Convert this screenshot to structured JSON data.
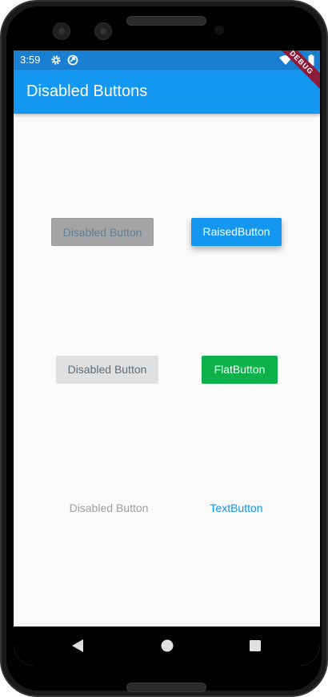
{
  "status_bar": {
    "time": "3:59",
    "color": "#1a7fd0"
  },
  "app_bar": {
    "title": "Disabled Buttons",
    "color": "#1497f0"
  },
  "debug_banner": "DEBUG",
  "buttons": {
    "disabled_raised": "Disabled Button",
    "raised": "RaisedButton",
    "disabled_flat": "Disabled Button",
    "flat": "FlatButton",
    "disabled_text": "Disabled Button",
    "text": "TextButton"
  },
  "colors": {
    "raised": "#1497f0",
    "flat": "#0cb14a",
    "text": "#1497f0",
    "disabled_fill": "#a4a4a4",
    "disabled_flat_fill": "#e0e0e0",
    "disabled_text": "#9e9e9e"
  },
  "icons": {
    "status": [
      "gear-icon",
      "sync-icon",
      "wifi-icon",
      "battery-icon"
    ],
    "nav": [
      "back-icon",
      "home-icon",
      "recents-icon"
    ]
  }
}
